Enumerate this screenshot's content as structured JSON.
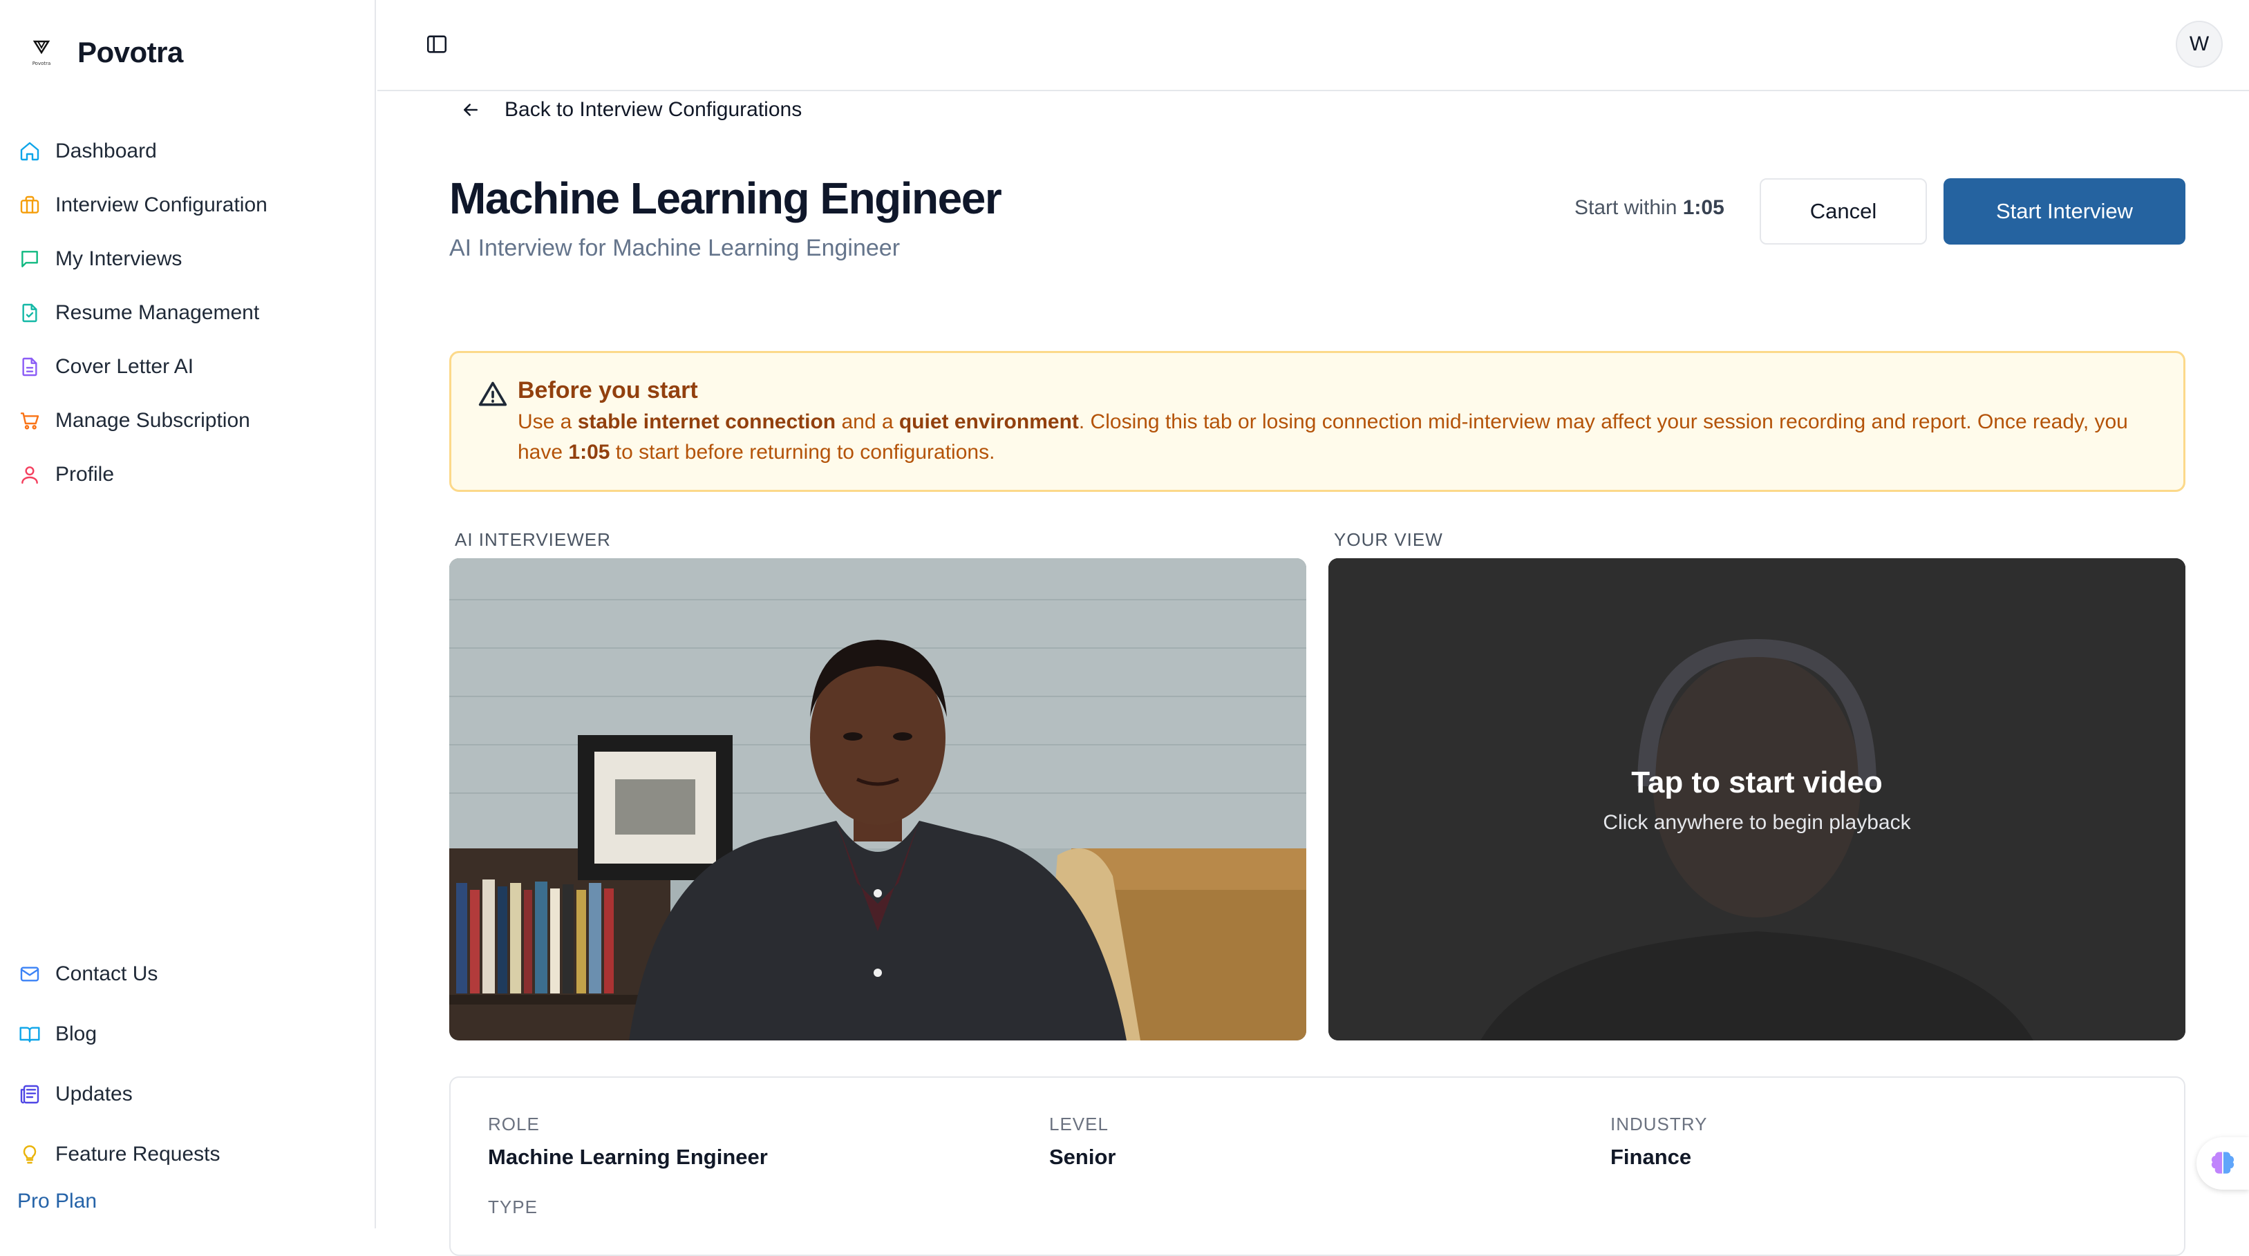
{
  "app": {
    "name": "Povotra",
    "logo_caption": "Povotra"
  },
  "sidebar": {
    "items": [
      {
        "label": "Dashboard",
        "icon": "home-icon",
        "color": "#0ea5e9"
      },
      {
        "label": "Interview Configuration",
        "icon": "briefcase-icon",
        "color": "#f59e0b"
      },
      {
        "label": "My Interviews",
        "icon": "message-icon",
        "color": "#10b981"
      },
      {
        "label": "Resume Management",
        "icon": "file-check-icon",
        "color": "#14b8a6"
      },
      {
        "label": "Cover Letter AI",
        "icon": "file-text-icon",
        "color": "#8b5cf6"
      },
      {
        "label": "Manage Subscription",
        "icon": "cart-icon",
        "color": "#f97316"
      },
      {
        "label": "Profile",
        "icon": "user-icon",
        "color": "#f43f5e"
      }
    ],
    "bottom_items": [
      {
        "label": "Contact Us",
        "icon": "mail-icon",
        "color": "#3b82f6"
      },
      {
        "label": "Blog",
        "icon": "book-icon",
        "color": "#0ea5e9"
      },
      {
        "label": "Updates",
        "icon": "newspaper-icon",
        "color": "#4f46e5"
      },
      {
        "label": "Feature Requests",
        "icon": "lightbulb-icon",
        "color": "#eab308"
      }
    ],
    "plan": "Pro Plan"
  },
  "topbar": {
    "avatar_initial": "W",
    "toggle_icon": "sidebar-toggle-icon"
  },
  "page": {
    "back_label": "Back to Interview Configurations",
    "title": "Machine Learning Engineer",
    "subtitle": "AI Interview for Machine Learning Engineer",
    "start_within_prefix": "Start within",
    "countdown": "1:05",
    "cancel_label": "Cancel",
    "start_label": "Start Interview"
  },
  "notice": {
    "title": "Before you start",
    "t1": "Use a ",
    "b1": "stable internet connection",
    "t2": " and a ",
    "b2": "quiet environment",
    "t3": ". Closing this tab or losing connection mid-interview may affect your session recording and report. Once ready, you have ",
    "b3": "1:05",
    "t4": " to start before returning to configurations."
  },
  "videos": {
    "ai_label": "AI INTERVIEWER",
    "your_label": "YOUR VIEW",
    "overlay_title": "Tap to start video",
    "overlay_sub": "Click anywhere to begin playback"
  },
  "details": {
    "role_label": "ROLE",
    "role": "Machine Learning Engineer",
    "level_label": "LEVEL",
    "level": "Senior",
    "industry_label": "INDUSTRY",
    "industry": "Finance",
    "type_label": "TYPE"
  },
  "colors": {
    "accent": "#2563a0",
    "warning_bg": "#fffbeb",
    "warning_border": "#fcd98a",
    "warning_text": "#b45309"
  }
}
